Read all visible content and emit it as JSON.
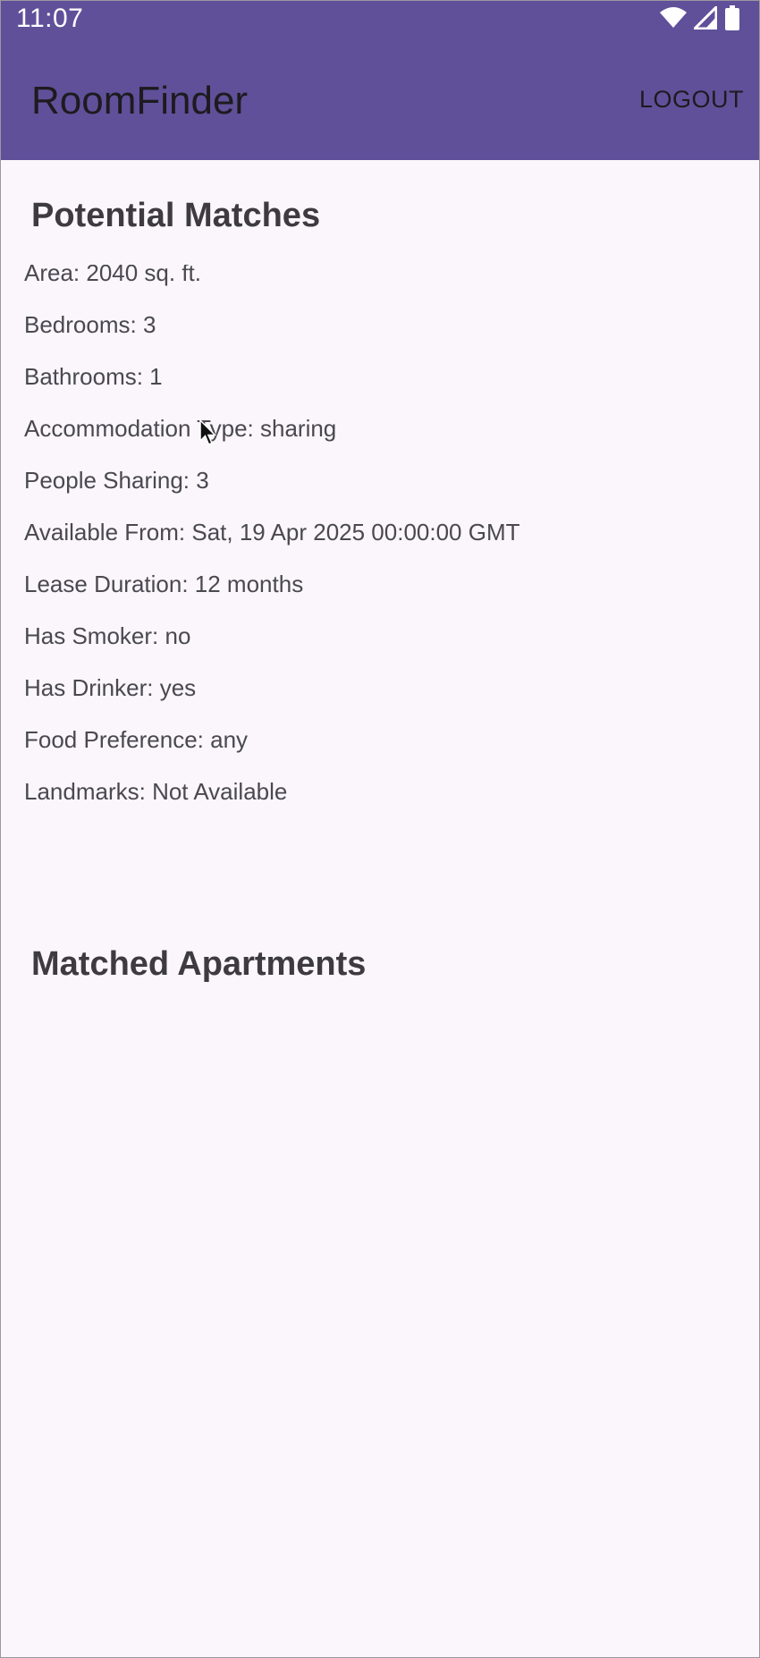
{
  "status_bar": {
    "time": "11:07",
    "icons": [
      "wifi-icon",
      "cellular-signal-icon",
      "battery-icon"
    ]
  },
  "app_bar": {
    "title": "RoomFinder",
    "logout_label": "LOGOUT"
  },
  "potential_matches": {
    "title": "Potential Matches",
    "details": [
      "Area: 2040 sq. ft.",
      "Bedrooms: 3",
      "Bathrooms: 1",
      "Accommodation Type: sharing",
      "People Sharing: 3",
      "Available From: Sat, 19 Apr 2025 00:00:00 GMT",
      "Lease Duration: 12 months",
      "Has Smoker: no",
      "Has Drinker: yes",
      "Food Preference: any",
      "Landmarks: Not Available"
    ]
  },
  "matched_apartments": {
    "title": "Matched Apartments"
  },
  "colors": {
    "app_bar": "#60509a",
    "background": "#faf6fc",
    "heading_text": "#3d3b40",
    "body_text": "#4a4850"
  }
}
